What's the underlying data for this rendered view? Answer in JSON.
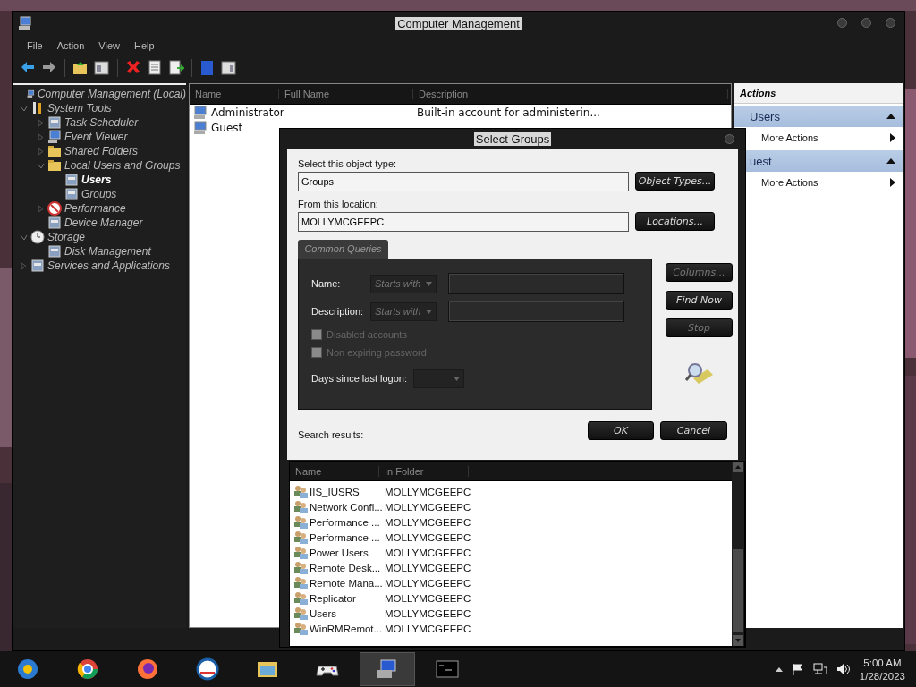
{
  "window": {
    "title": "Computer Management",
    "menu": [
      "File",
      "Action",
      "View",
      "Help"
    ]
  },
  "tree": [
    {
      "label": "Computer Management (Local)",
      "selected": false,
      "children": [
        {
          "label": "System Tools",
          "expanded": true,
          "selected": false,
          "children": [
            {
              "label": "Task Scheduler",
              "expanded": false,
              "selected": false
            },
            {
              "label": "Event Viewer",
              "expanded": false,
              "selected": false
            },
            {
              "label": "Shared Folders",
              "expanded": false,
              "selected": false
            },
            {
              "label": "Local Users and Groups",
              "expanded": true,
              "selected": false,
              "children": [
                {
                  "label": "Users",
                  "selected": true
                },
                {
                  "label": "Groups",
                  "selected": false
                }
              ]
            },
            {
              "label": "Performance",
              "expanded": false,
              "selected": false
            },
            {
              "label": "Device Manager",
              "selected": false
            }
          ]
        },
        {
          "label": "Storage",
          "expanded": true,
          "selected": false,
          "children": [
            {
              "label": "Disk Management",
              "selected": false
            }
          ]
        },
        {
          "label": "Services and Applications",
          "expanded": false,
          "selected": false
        }
      ]
    }
  ],
  "list": {
    "columns": [
      "Name",
      "Full Name",
      "Description"
    ],
    "rows": [
      {
        "name": "Administrator",
        "description": "Built-in account for administerin..."
      },
      {
        "name": "Guest"
      }
    ]
  },
  "actions": {
    "title": "Actions",
    "sections": [
      {
        "header": "Users",
        "expanded": true,
        "items": [
          "More Actions"
        ]
      },
      {
        "header": "uest",
        "expanded": true,
        "items": [
          "More Actions"
        ]
      }
    ]
  },
  "dialog": {
    "title": "Select Groups",
    "object_type_label": "Select this object type:",
    "object_type": "Groups",
    "object_types_button": "Object Types...",
    "location_label": "From this location:",
    "location": "MOLLYMCGEEPC",
    "locations_button": "Locations...",
    "tab": "Common Queries",
    "name_label": "Name:",
    "name_filter": "Starts with",
    "description_label": "Description:",
    "description_filter": "Starts with",
    "checkboxes": [
      {
        "label": "Disabled accounts",
        "checked": false,
        "disabled": true
      },
      {
        "label": "Non expiring password",
        "checked": false,
        "disabled": true
      }
    ],
    "days_label": "Days since last logon:",
    "side_buttons": [
      {
        "label": "Columns...",
        "disabled": true
      },
      {
        "label": "Find Now",
        "disabled": false
      },
      {
        "label": "Stop",
        "disabled": true
      }
    ],
    "ok": "OK",
    "cancel": "Cancel",
    "results_label": "Search results:",
    "results": {
      "columns": [
        "Name",
        "In Folder"
      ],
      "rows": [
        {
          "name": "IIS_IUSRS",
          "folder": "MOLLYMCGEEPC"
        },
        {
          "name": "Network Confi...",
          "folder": "MOLLYMCGEEPC"
        },
        {
          "name": "Performance ...",
          "folder": "MOLLYMCGEEPC"
        },
        {
          "name": "Performance ...",
          "folder": "MOLLYMCGEEPC"
        },
        {
          "name": "Power Users",
          "folder": "MOLLYMCGEEPC"
        },
        {
          "name": "Remote Desk...",
          "folder": "MOLLYMCGEEPC"
        },
        {
          "name": "Remote Mana...",
          "folder": "MOLLYMCGEEPC"
        },
        {
          "name": "Replicator",
          "folder": "MOLLYMCGEEPC"
        },
        {
          "name": "Users",
          "folder": "MOLLYMCGEEPC"
        },
        {
          "name": "WinRMRemot...",
          "folder": "MOLLYMCGEEPC"
        }
      ]
    }
  },
  "taskbar": {
    "apps": [
      {
        "selected": false
      },
      {
        "selected": false
      },
      {
        "selected": false
      },
      {
        "selected": false
      },
      {
        "selected": false
      },
      {
        "selected": false
      },
      {
        "selected": true
      },
      {
        "selected": false
      }
    ],
    "clock": {
      "time": "5:00 AM",
      "date": "1/28/2023"
    }
  }
}
